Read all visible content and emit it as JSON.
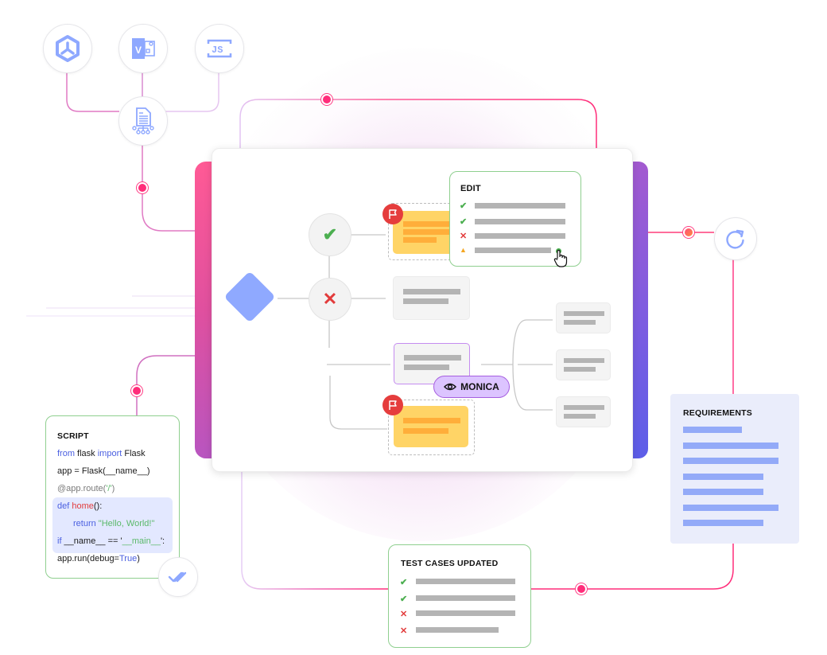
{
  "top_icons": [
    {
      "name": "hexagon-network-icon"
    },
    {
      "name": "visio-icon",
      "label": "V"
    },
    {
      "name": "js-icon",
      "label": "JS"
    }
  ],
  "hub_icon": {
    "name": "document-network-icon"
  },
  "sync_icon": {
    "name": "refresh-icon"
  },
  "done_icon": {
    "name": "double-check-icon"
  },
  "edit_card": {
    "title": "EDIT",
    "items": [
      {
        "status": "pass",
        "glyph": "✔"
      },
      {
        "status": "pass",
        "glyph": "✔"
      },
      {
        "status": "fail",
        "glyph": "✕"
      },
      {
        "status": "warning",
        "glyph": "▲"
      }
    ]
  },
  "script_card": {
    "title": "SCRIPT",
    "lines": {
      "l1_kw1": "from",
      "l1_t1": " flask ",
      "l1_kw2": "import",
      "l1_t2": " Flask",
      "l2": "app = Flask(__name__)",
      "l3_dec": "@app.route(",
      "l3_str": "'/'",
      "l3_end": ")",
      "l4_kw": "def",
      "l4_fn": " home",
      "l4_end": "():",
      "l5_kw": "return",
      "l5_str": " \"Hello, World!\"",
      "l6_kw": "if",
      "l6_t": " __name__ == '",
      "l6_str": "__main__",
      "l6_end": "':",
      "l7_t": "app.run(debug=",
      "l7_kw": "True",
      "l7_end": ")"
    }
  },
  "test_card": {
    "title": "TEST CASES UPDATED",
    "items": [
      {
        "status": "pass",
        "glyph": "✔"
      },
      {
        "status": "pass",
        "glyph": "✔"
      },
      {
        "status": "fail",
        "glyph": "✕"
      },
      {
        "status": "fail",
        "glyph": "✕"
      }
    ]
  },
  "requirements_card": {
    "title": "REQUIREMENTS"
  },
  "flow": {
    "pass_glyph": "✔",
    "fail_glyph": "✕",
    "user_pill": "MONICA"
  },
  "colors": {
    "accent_pink": "#ff2d7a",
    "accent_purple": "#a65ee0",
    "icon_blue": "#8ea8ff",
    "pass": "#4caf50",
    "fail": "#e23b3b",
    "warning": "#f4a623"
  }
}
